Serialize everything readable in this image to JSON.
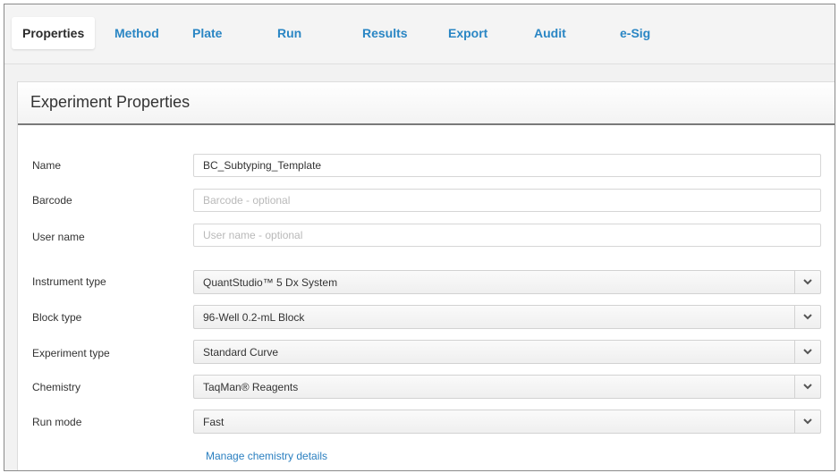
{
  "tabs": [
    {
      "label": "Properties"
    },
    {
      "label": "Method"
    },
    {
      "label": "Plate"
    },
    {
      "label": "Run"
    },
    {
      "label": "Results"
    },
    {
      "label": "Export"
    },
    {
      "label": "Audit"
    },
    {
      "label": "e-Sig"
    }
  ],
  "active_tab": "Properties",
  "panel": {
    "title": "Experiment Properties"
  },
  "fields": {
    "name": {
      "label": "Name",
      "value": "BC_Subtyping_Template"
    },
    "barcode": {
      "label": "Barcode",
      "value": "",
      "placeholder": "Barcode - optional"
    },
    "user_name": {
      "label": "User name",
      "value": "",
      "placeholder": "User name - optional"
    }
  },
  "selects": {
    "instrument_type": {
      "label": "Instrument type",
      "value": "QuantStudio™ 5 Dx System"
    },
    "block_type": {
      "label": "Block type",
      "value": "96-Well 0.2-mL Block"
    },
    "experiment_type": {
      "label": "Experiment type",
      "value": "Standard Curve"
    },
    "chemistry": {
      "label": "Chemistry",
      "value": "TaqMan® Reagents"
    },
    "run_mode": {
      "label": "Run mode",
      "value": "Fast"
    }
  },
  "links": {
    "manage_chemistry": "Manage chemistry details"
  },
  "colors": {
    "accent": "#2a86c4",
    "link": "#2a7fc0"
  },
  "icons": {
    "dropdown": "chevron-down-icon"
  }
}
